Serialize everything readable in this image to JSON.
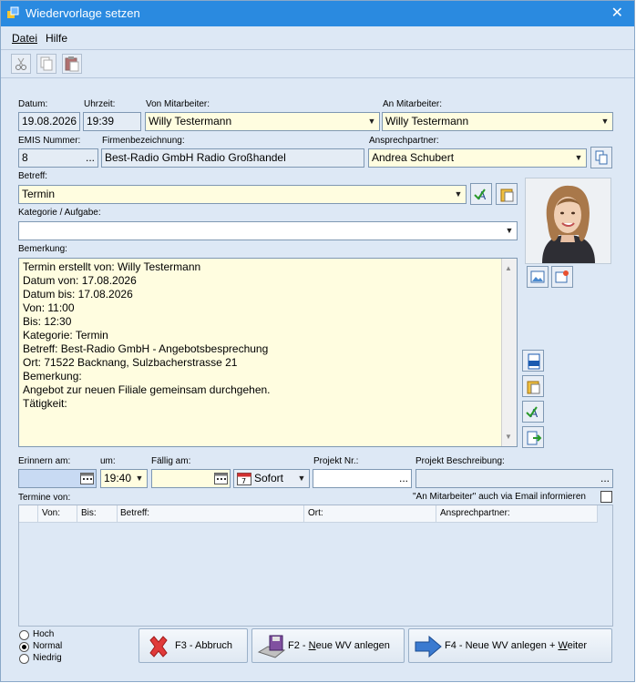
{
  "window": {
    "title": "Wiedervorlage setzen"
  },
  "menu": {
    "datei": "Datei",
    "hilfe": "Hilfe"
  },
  "toolbar": {
    "cut": "cut-icon",
    "copy": "copy-icon",
    "paste": "paste-icon"
  },
  "form": {
    "datum_label": "Datum:",
    "datum_value": "19.08.2026",
    "uhrzeit_label": "Uhrzeit:",
    "uhrzeit_value": "19:39",
    "von_label": "Von Mitarbeiter:",
    "von_value": "Willy Testermann",
    "an_label": "An Mitarbeiter:",
    "an_value": "Willy Testermann",
    "emis_label": "EMIS Nummer:",
    "emis_value": "8",
    "firma_label": "Firmenbezeichnung:",
    "firma_value": "Best-Radio GmbH Radio Großhandel",
    "ansprech_label": "Ansprechpartner:",
    "ansprech_value": "Andrea Schubert",
    "betreff_label": "Betreff:",
    "betreff_value": "Termin",
    "kategorie_label": "Kategorie / Aufgabe:",
    "kategorie_value": "",
    "bemerkung_label": "Bemerkung:",
    "bemerkung_lines": [
      "Termin erstellt von: Willy Testermann",
      "Datum von: 17.08.2026",
      "Datum bis: 17.08.2026",
      "Von: 11:00",
      "Bis: 12:30",
      "Kategorie: Termin",
      "Betreff: Best-Radio GmbH - Angebotsbesprechung",
      "Ort: 71522 Backnang, Sulzbacherstrasse 21",
      "Bemerkung:",
      "Angebot zur neuen Filiale gemeinsam durchgehen.",
      "Tätigkeit:"
    ],
    "erinnern_label": "Erinnern am:",
    "erinnern_value": "",
    "um_label": "um:",
    "um_value": "19:40",
    "faellig_label": "Fällig am:",
    "faellig_value": "",
    "sofort_label": "Sofort",
    "projekt_label": "Projekt Nr.:",
    "projekt_value": "",
    "projekt_beschr_label": "Projekt Beschreibung:",
    "projekt_beschr_value": "",
    "termine_label": "Termine von:",
    "email_info_label": "\"An Mitarbeiter\" auch via Email informieren",
    "ellipsis": "..."
  },
  "table": {
    "columns": [
      "Von:",
      "Bis:",
      "Betreff:",
      "Ort:",
      "Ansprechpartner:"
    ]
  },
  "priority": {
    "options": [
      "Hoch",
      "Normal",
      "Niedrig"
    ],
    "selected": "Normal"
  },
  "buttons": {
    "abbruch": "F3 - Abbruch",
    "neu_prefix": "F2 - ",
    "neu_u": "N",
    "neu_suffix": "eue WV anlegen",
    "weiter_prefix": "F4 - Neue WV anlegen + ",
    "weiter_u": "W",
    "weiter_suffix": "eiter"
  }
}
